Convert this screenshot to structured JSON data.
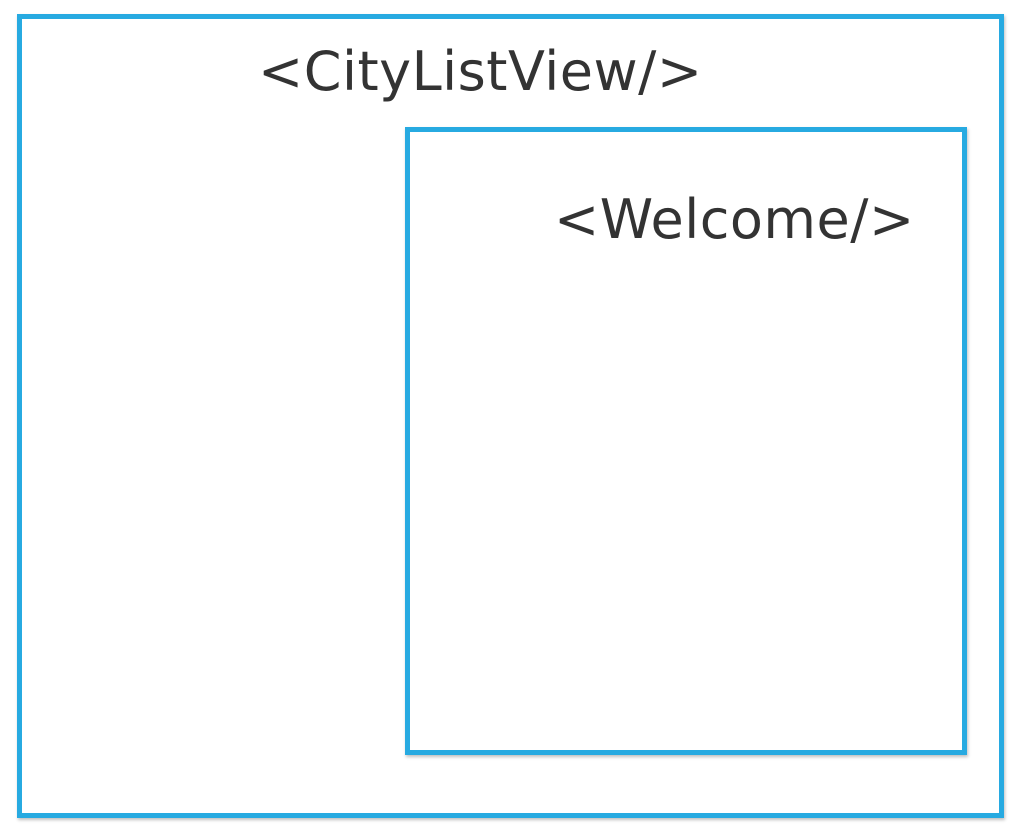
{
  "diagram": {
    "outer_component": {
      "label": "<CityListView/>"
    },
    "inner_component": {
      "label": "<Welcome/>"
    },
    "colors": {
      "border": "#27aae1",
      "text": "#333333",
      "background": "#ffffff"
    }
  }
}
